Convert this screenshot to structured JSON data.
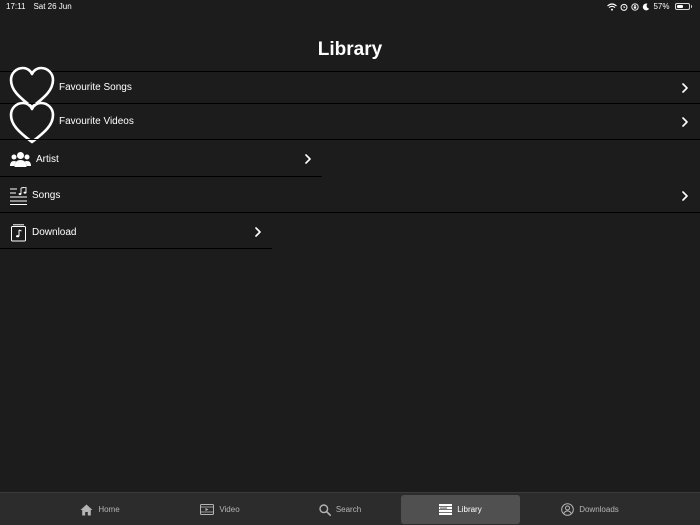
{
  "status_bar": {
    "time": "17:11",
    "date": "Sat 26 Jun",
    "battery_percent": "57%",
    "battery_level": 0.57,
    "icons": [
      "wifi-icon",
      "alarm-icon",
      "lock-rotation-icon",
      "moon-icon",
      "battery-icon"
    ]
  },
  "header": {
    "title": "Library"
  },
  "library_items": [
    {
      "label": "Favourite Songs",
      "icon": "heart-icon"
    },
    {
      "label": "Favourite Videos",
      "icon": "heart-icon"
    },
    {
      "label": "Artist",
      "icon": "people-icon"
    },
    {
      "label": "Songs",
      "icon": "music-list-icon"
    },
    {
      "label": "Download",
      "icon": "music-note-box-icon"
    }
  ],
  "tab_bar": {
    "tabs": [
      {
        "label": "Home",
        "icon": "home-icon",
        "active": false
      },
      {
        "label": "Video",
        "icon": "video-icon",
        "active": false
      },
      {
        "label": "Search",
        "icon": "search-icon",
        "active": false
      },
      {
        "label": "Library",
        "icon": "library-icon",
        "active": true
      },
      {
        "label": "Downloads",
        "icon": "user-circle-icon",
        "active": false
      }
    ]
  },
  "colors": {
    "background": "#1c1c1c",
    "tab_bar": "#2c2c2c",
    "active_tab": "#505050",
    "text": "#ffffff",
    "inactive_tab_text": "#b5b5b5"
  }
}
